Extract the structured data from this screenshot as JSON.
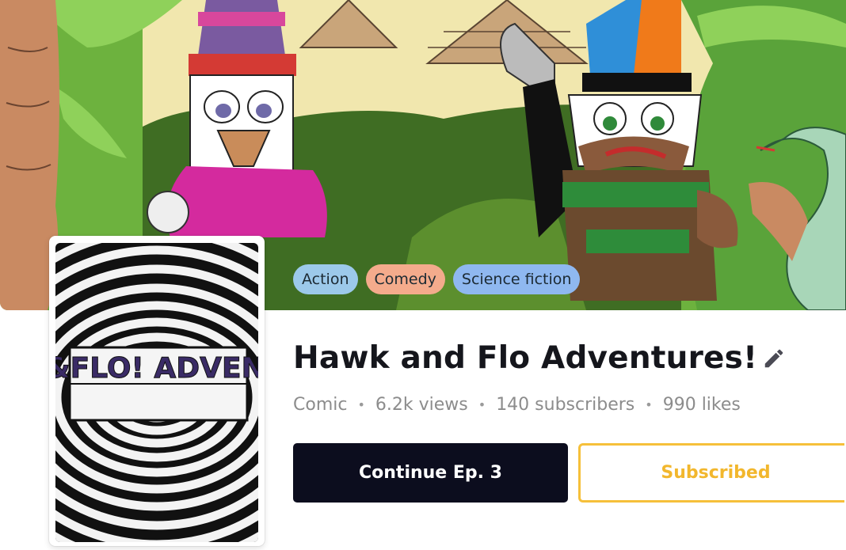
{
  "series": {
    "title": "Hawk and Flo Adventures!",
    "cover_logo": "HAWK&FLO! ADVENTURES"
  },
  "tags": [
    {
      "label": "Action",
      "color": "#9cc9ea"
    },
    {
      "label": "Comedy",
      "color": "#f4ab8c"
    },
    {
      "label": "Science fiction",
      "color": "#8fb8f0"
    }
  ],
  "meta": {
    "type": "Comic",
    "views": "6.2k views",
    "subscribers": "140 subscribers",
    "likes": "990 likes"
  },
  "actions": {
    "continue_label": "Continue Ep. 3",
    "subscribed_label": "Subscribed"
  },
  "icons": {
    "edit": "pencil-icon"
  },
  "colors": {
    "primary_dark": "#0c0d1e",
    "accent_yellow": "#f6c03a",
    "title_text": "#15161c",
    "meta_text": "#8c8c8c"
  }
}
